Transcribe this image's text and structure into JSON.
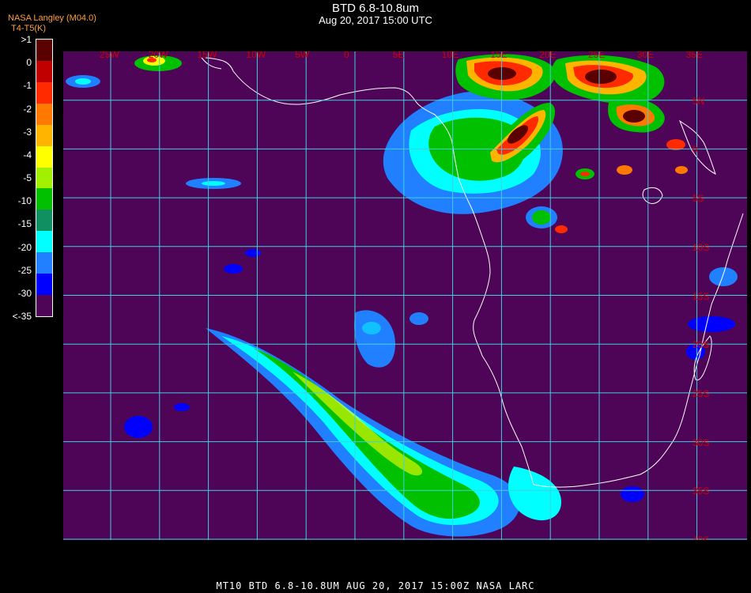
{
  "header": {
    "title": "BTD 6.8-10.8um",
    "subtitle": "Aug 20, 2017 15:00 UTC",
    "org_label": "NASA Langley (M04.0)",
    "colorbar_label": "T4-T5(K)"
  },
  "colorbar": {
    "ticks": [
      ">1",
      "0",
      "-1",
      "-2",
      "-3",
      "-4",
      "-5",
      "-10",
      "-15",
      "-20",
      "-25",
      "-30",
      "<-35"
    ],
    "colors": [
      "#5a0000",
      "#c00000",
      "#ff2a00",
      "#ff7800",
      "#ffb400",
      "#ffff00",
      "#a0f000",
      "#00c000",
      "#109060",
      "#00ffff",
      "#2080ff",
      "#0000ff",
      "#4e0457"
    ]
  },
  "map": {
    "background_color": "#4e0457",
    "grid_color": "#40d0e0",
    "coast_color": "#ffffff",
    "label_color": "#d00000",
    "lon_labels": [
      "25W",
      "20W",
      "15W",
      "10W",
      "5W",
      "0",
      "5E",
      "10E",
      "15E",
      "20E",
      "25E",
      "30E",
      "35E"
    ],
    "lat_labels": [
      "5N",
      "0",
      "5S",
      "10S",
      "15S",
      "20S",
      "25S",
      "30S",
      "35S",
      "40S"
    ]
  },
  "footer": {
    "text": "MT10  BTD 6.8-10.8UM   AUG 20, 2017 15:00Z   NASA LARC"
  }
}
